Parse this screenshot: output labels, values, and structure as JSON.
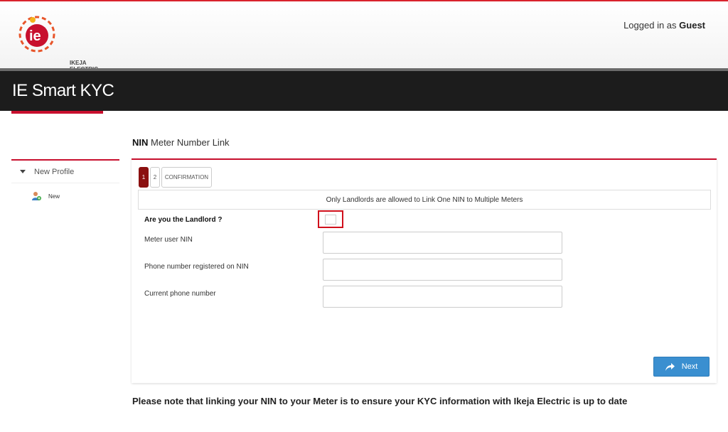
{
  "header": {
    "logo_text_line1": "IKEJA",
    "logo_text_line2": "ELECTRIC",
    "logged_prefix": "Logged in as",
    "logged_user": "Guest"
  },
  "titlebar": {
    "title": "IE Smart KYC"
  },
  "sidebar": {
    "section_label": "New Profile",
    "items": [
      {
        "label": "New",
        "icon": "user-add-icon"
      }
    ]
  },
  "page": {
    "title_bold": "NIN",
    "title_rest": "Meter Number Link"
  },
  "steps": [
    {
      "label": "1",
      "active": true
    },
    {
      "label": "2",
      "active": false
    },
    {
      "label": "CONFIRMATION",
      "active": false
    }
  ],
  "form": {
    "notice": "Only Landlords are allowed to Link One NIN to Multiple Meters",
    "landlord_label": "Are you the Landlord ?",
    "meter_nin_label": "Meter user NIN",
    "meter_nin_value": "",
    "phone_nin_label": "Phone number registered on NIN",
    "phone_nin_value": "",
    "current_phone_label": "Current phone number",
    "current_phone_value": "",
    "next_label": "Next"
  },
  "footer_note": "Please note that linking your NIN to your Meter is to ensure your KYC information with Ikeja Electric is up to date",
  "colors": {
    "brand_red": "#c8102e",
    "button_blue": "#3a8fd0",
    "titlebar": "#1c1c1c"
  }
}
